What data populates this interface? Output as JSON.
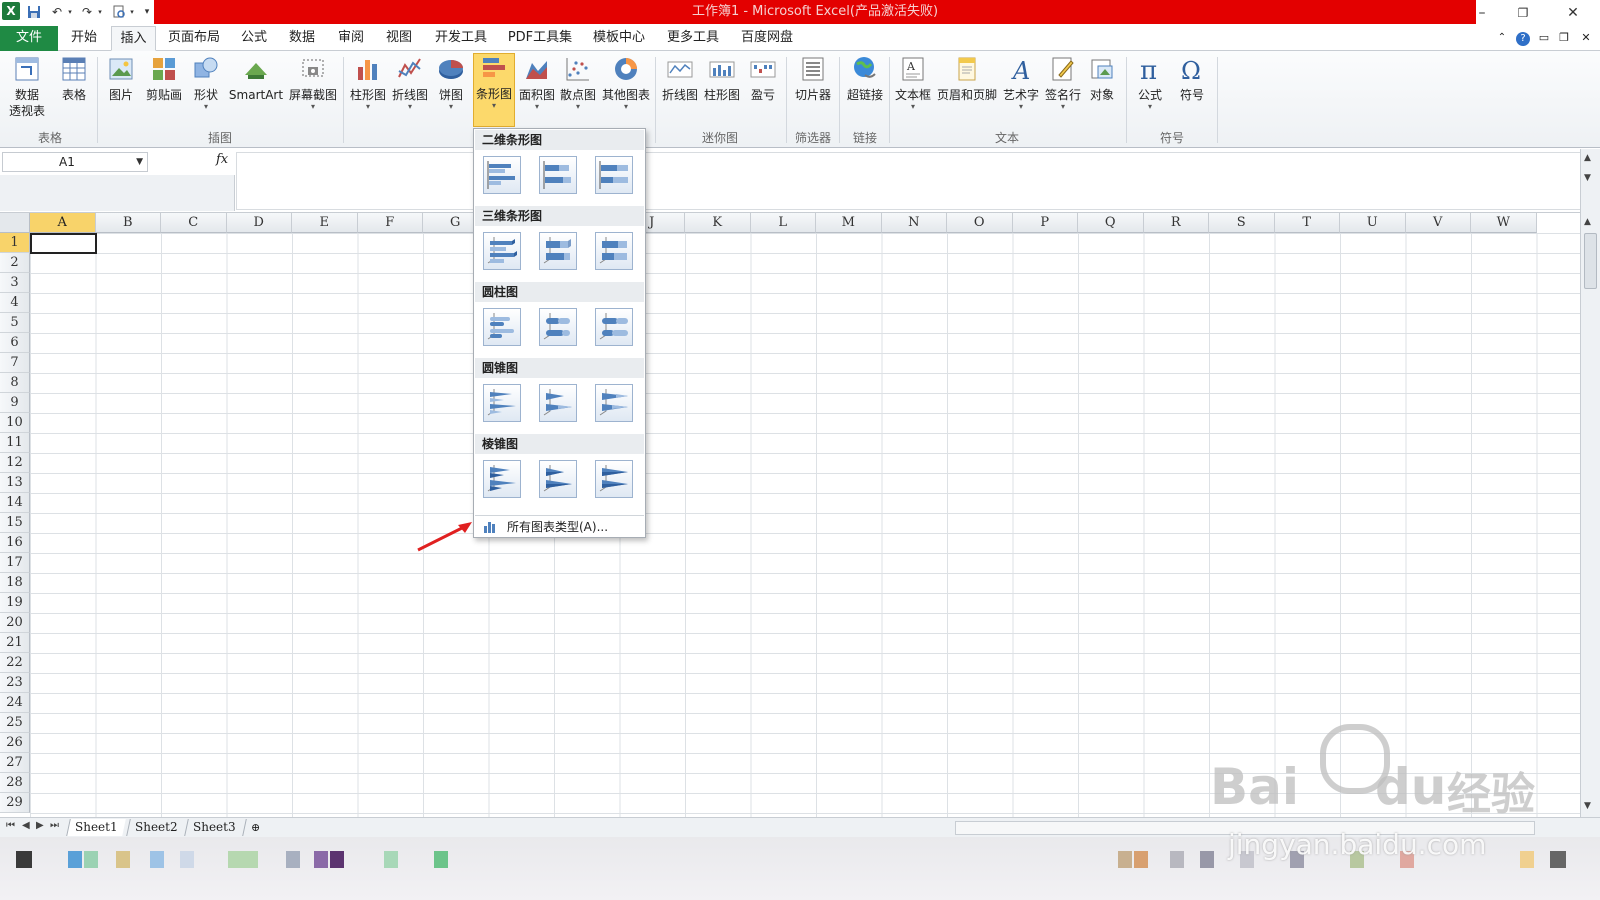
{
  "window": {
    "title": "工作簿1 - Microsoft Excel(产品激活失败)",
    "controls": [
      "minimize",
      "restore",
      "close"
    ]
  },
  "quick_access": {
    "icons": [
      "excel-logo",
      "save-icon",
      "undo-icon",
      "redo-icon",
      "print-preview-icon",
      "customize-icon"
    ]
  },
  "tabs": [
    {
      "label": "文件",
      "active": false,
      "kind": "file"
    },
    {
      "label": "开始"
    },
    {
      "label": "插入",
      "active": true
    },
    {
      "label": "页面布局"
    },
    {
      "label": "公式"
    },
    {
      "label": "数据"
    },
    {
      "label": "审阅"
    },
    {
      "label": "视图"
    },
    {
      "label": "开发工具"
    },
    {
      "label": "PDF工具集"
    },
    {
      "label": "模板中心"
    },
    {
      "label": "更多工具"
    },
    {
      "label": "百度网盘"
    }
  ],
  "ribbon": {
    "groups": [
      {
        "label": "表格",
        "buttons": [
          {
            "label": "数据",
            "label2": "透视表"
          },
          {
            "label": "表格"
          }
        ]
      },
      {
        "label": "插图",
        "buttons": [
          {
            "label": "图片"
          },
          {
            "label": "剪贴画"
          },
          {
            "label": "形状"
          },
          {
            "label": "SmartArt"
          },
          {
            "label": "屏幕截图"
          }
        ]
      },
      {
        "label": "图表",
        "buttons": [
          {
            "label": "柱形图"
          },
          {
            "label": "折线图"
          },
          {
            "label": "饼图"
          },
          {
            "label": "条形图",
            "active": true
          },
          {
            "label": "面积图"
          },
          {
            "label": "散点图"
          },
          {
            "label": "其他图表"
          }
        ]
      },
      {
        "label": "迷你图",
        "buttons": [
          {
            "label": "折线图"
          },
          {
            "label": "柱形图"
          },
          {
            "label": "盈亏"
          }
        ]
      },
      {
        "label": "筛选器",
        "buttons": [
          {
            "label": "切片器"
          }
        ]
      },
      {
        "label": "链接",
        "buttons": [
          {
            "label": "超链接"
          }
        ]
      },
      {
        "label": "文本",
        "buttons": [
          {
            "label": "文本框"
          },
          {
            "label": "页眉和页脚"
          },
          {
            "label": "艺术字"
          },
          {
            "label": "签名行"
          },
          {
            "label": "对象"
          }
        ]
      },
      {
        "label": "符号",
        "buttons": [
          {
            "label": "公式"
          },
          {
            "label": "符号"
          }
        ]
      }
    ]
  },
  "formula_bar": {
    "name_box": "A1",
    "fx": "fx",
    "value": ""
  },
  "grid": {
    "columns": [
      "A",
      "B",
      "C",
      "D",
      "E",
      "F",
      "G",
      "H",
      "I",
      "J",
      "K",
      "L",
      "M",
      "N",
      "O",
      "P",
      "Q",
      "R",
      "S",
      "T",
      "U",
      "V",
      "W"
    ],
    "rows": [
      "1",
      "2",
      "3",
      "4",
      "5",
      "6",
      "7",
      "8",
      "9",
      "10",
      "11",
      "12",
      "13",
      "14",
      "15",
      "16",
      "17",
      "18",
      "19",
      "20",
      "21",
      "22",
      "23",
      "24",
      "25",
      "26",
      "27",
      "28",
      "29"
    ],
    "active_cell": "A1"
  },
  "sheets": [
    {
      "label": "Sheet1",
      "active": true
    },
    {
      "label": "Sheet2"
    },
    {
      "label": "Sheet3"
    }
  ],
  "bar_chart_menu": {
    "sections": [
      {
        "title": "二维条形图",
        "items": [
          "簇状条形图",
          "堆积条形图",
          "百分比堆积条形图"
        ]
      },
      {
        "title": "三维条形图",
        "items": [
          "三维簇状条形图",
          "三维堆积条形图",
          "三维百分比堆积条形图"
        ]
      },
      {
        "title": "圆柱图",
        "items": [
          "簇状水平圆柱图",
          "堆积水平圆柱图",
          "百分比堆积水平圆柱图"
        ]
      },
      {
        "title": "圆锥图",
        "items": [
          "簇状水平圆锥图",
          "堆积水平圆锥图",
          "百分比堆积水平圆锥图"
        ]
      },
      {
        "title": "棱锥图",
        "items": [
          "簇状水平棱锥图",
          "堆积水平棱锥图",
          "百分比堆积水平棱锥图"
        ]
      }
    ],
    "all_types": "所有图表类型(A)..."
  },
  "watermark": {
    "brand": "Bai",
    "brand2": "du",
    "cn": "经验",
    "url": "jingyan.baidu.com"
  },
  "colors": {
    "title_red": "#e30000",
    "file_tab": "#1f8a44",
    "highlight": "#fcd96b",
    "accent_blue": "#4f81bd"
  }
}
